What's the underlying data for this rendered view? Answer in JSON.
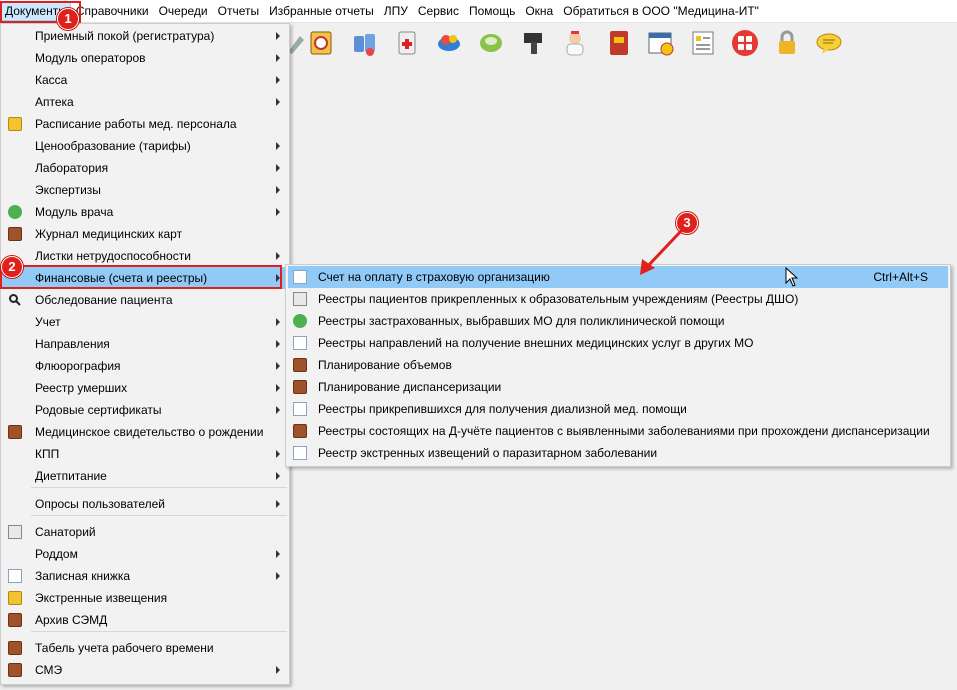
{
  "menubar": {
    "items": [
      "Документы",
      "Справочники",
      "Очереди",
      "Отчеты",
      "Избранные отчеты",
      "ЛПУ",
      "Сервис",
      "Помощь",
      "Окна",
      "Обратиться в ООО \"Медицина-ИТ\""
    ]
  },
  "badges": {
    "b1": "1",
    "b2": "2",
    "b3": "3"
  },
  "dropdown": {
    "items": [
      "Приемный покой (регистратура)",
      "Модуль операторов",
      "Касса",
      "Аптека",
      "Расписание работы мед. персонала",
      "Ценообразование (тарифы)",
      "Лаборатория",
      "Экспертизы",
      "Модуль врача",
      "Журнал медицинских карт",
      "Листки нетрудоспособности",
      "Финансовые (счета и реестры)",
      "Обследование пациента",
      "Учет",
      "Направления",
      "Флюорография",
      "Реестр умерших",
      "Родовые сертификаты",
      "Медицинское свидетельство о рождении",
      "КПП",
      "Диетпитание",
      "Опросы пользователей",
      "Санаторий",
      "Роддом",
      "Записная книжка",
      "Экстренные извещения",
      "Архив СЭМД",
      "Табель учета рабочего времени",
      "СМЭ"
    ]
  },
  "submenu": {
    "items": [
      "Счет на оплату в страховую организацию",
      "Реестры пациентов прикрепленных к образовательным учреждениям (Реестры ДШО)",
      "Реестры застрахованных, выбравших МО для поликлинической помощи",
      "Реестры направлений на получение внешних медицинских услуг в других МО",
      "Планирование объемов",
      "Планирование диспансеризации",
      "Реестры прикрепившихся для получения диализной мед. помощи",
      "Реестры состоящих на Д-учёте пациентов с выявленными заболеваниями при прохождени диспансеризации",
      "Реестр экстренных извещений о паразитарном заболевании"
    ],
    "shortcut": "Ctrl+Alt+S"
  },
  "colors": {
    "highlight": "#91c9f7",
    "annotation": "#e0201b"
  }
}
